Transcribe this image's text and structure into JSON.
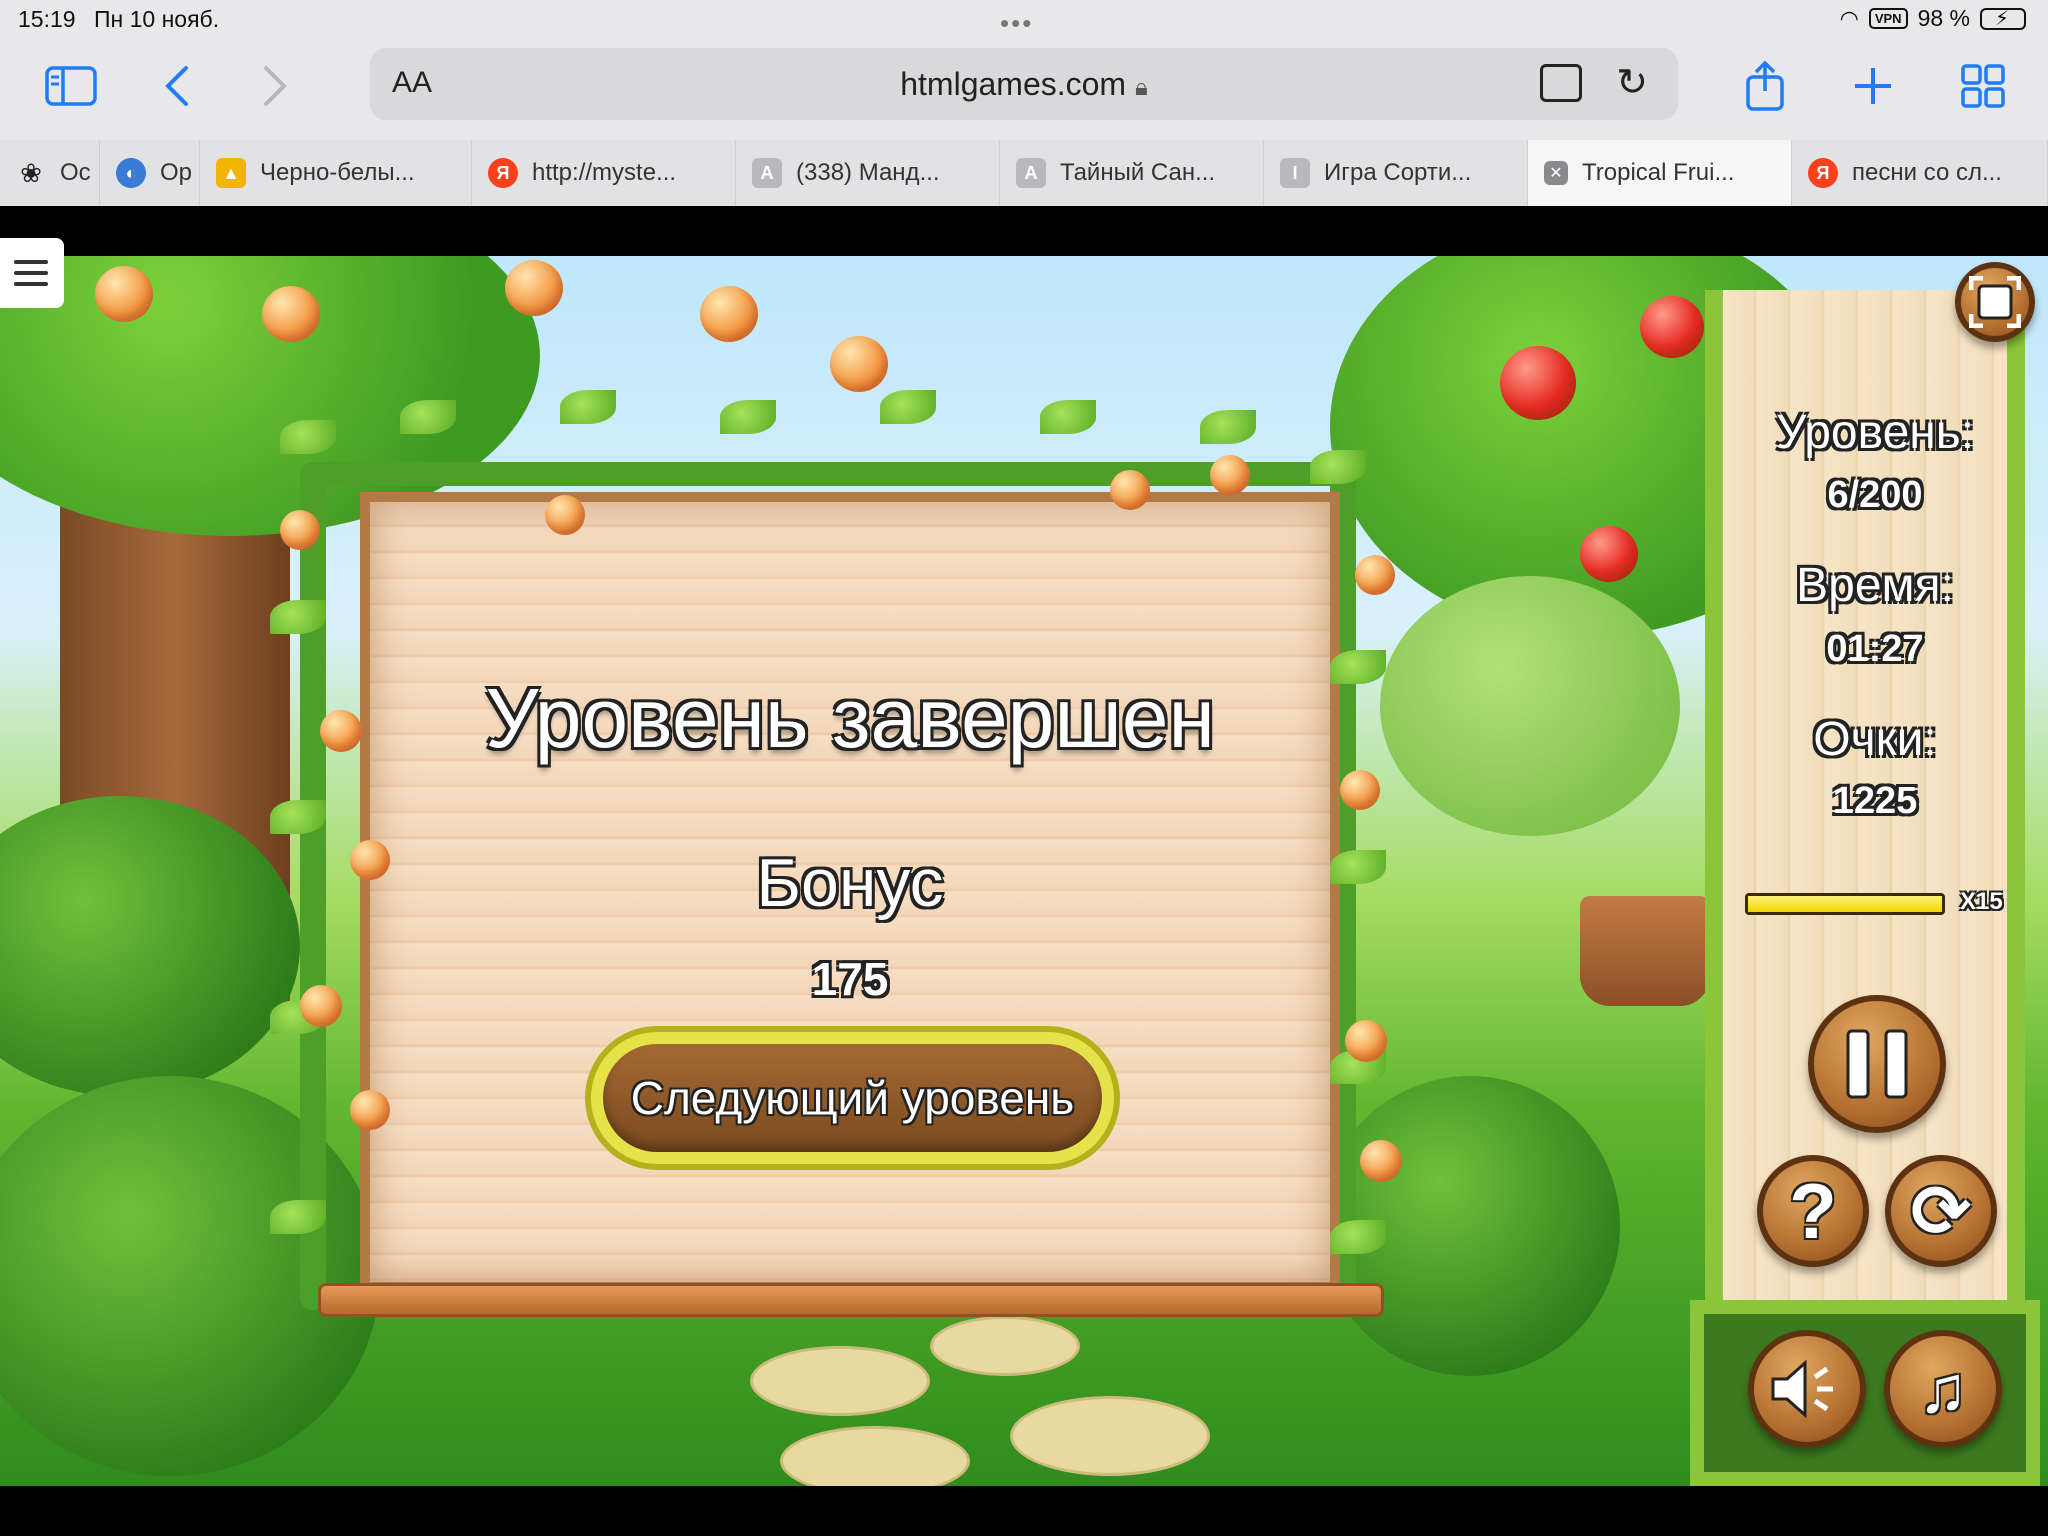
{
  "status_bar": {
    "time": "15:19",
    "date": "Пн 10 нояб.",
    "battery": "98 %",
    "vpn": "VPN"
  },
  "browser": {
    "text_size_label": "AA",
    "url": "htmlgames.com",
    "tabs": [
      {
        "label": "Oc",
        "icon": "paw-icon",
        "color": "#222222"
      },
      {
        "label": "Op",
        "icon": "globe-icon",
        "color": "#3a7bd5"
      },
      {
        "label": "Черно-белы...",
        "icon": "image-icon",
        "color": "#f2b400"
      },
      {
        "label": "http://myste...",
        "icon": "yandex-icon",
        "color": "#fc3f1d"
      },
      {
        "label": "(338) Манд...",
        "icon": "a-icon",
        "color": "#b9b9bd"
      },
      {
        "label": "Тайный Сан...",
        "icon": "a-icon",
        "color": "#b9b9bd"
      },
      {
        "label": "Игра Сорти...",
        "icon": "i-icon",
        "color": "#b9b9bd"
      },
      {
        "label": "Tropical Frui...",
        "icon": "close-icon",
        "color": "#8a8a8e",
        "active": true
      },
      {
        "label": "песни со сл...",
        "icon": "yandex-icon",
        "color": "#fc3f1d"
      }
    ]
  },
  "dialog": {
    "title": "Уровень завершен",
    "bonus_label": "Бонус",
    "bonus_value": "175",
    "next_button": "Следующий уровень"
  },
  "panel": {
    "level_label": "Уровень:",
    "level_value": "6/200",
    "time_label": "Время:",
    "time_value": "01:27",
    "score_label": "Очки:",
    "score_value": "1225",
    "multiplier": "X15",
    "multiplier_progress": 1.0
  },
  "icons": {
    "fullscreen": "fullscreen-icon",
    "pause": "pause-icon",
    "help": "help-icon",
    "restart": "restart-icon",
    "sound": "speaker-icon",
    "music": "music-note-icon"
  }
}
